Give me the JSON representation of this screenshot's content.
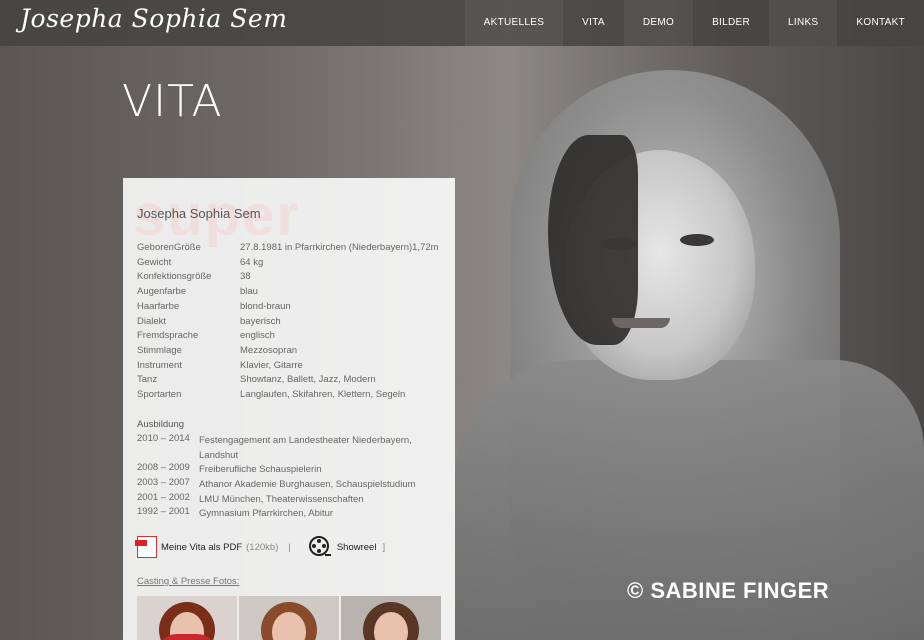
{
  "header": {
    "logo": "Josepha Sophia Sem",
    "nav": [
      "AKTUELLES",
      "VITA",
      "DEMO",
      "BILDER",
      "LINKS",
      "KONTAKT"
    ]
  },
  "page": {
    "title": "VITA",
    "copyright": "© SABINE FINGER"
  },
  "panel": {
    "bg_text": "super",
    "name": "Josepha Sophia Sem",
    "facts": [
      {
        "label": "GeborenGröße",
        "value": "27.8.1981 in Pfarrkirchen (Niederbayern)1,72m"
      },
      {
        "label": "Gewicht",
        "value": "64 kg"
      },
      {
        "label": "Konfektionsgröße",
        "value": "38"
      },
      {
        "label": "Augenfarbe",
        "value": "blau"
      },
      {
        "label": "Haarfarbe",
        "value": "blond-braun"
      },
      {
        "label": "Dialekt",
        "value": "bayerisch"
      },
      {
        "label": "Fremdsprache",
        "value": "englisch"
      },
      {
        "label": "Stimmlage",
        "value": "Mezzosopran"
      },
      {
        "label": "Instrument",
        "value": "Klavier, Gitarre"
      },
      {
        "label": "Tanz",
        "value": "Showtanz, Ballett, Jazz, Modern"
      },
      {
        "label": "Sportarten",
        "value": "Langlaufen, Skifahren, Klettern, Segeln"
      }
    ],
    "education_title": "Ausbildung",
    "education": [
      {
        "years": "2010 – 2014",
        "text": "Festengagement am Landestheater Niederbayern, Landshut"
      },
      {
        "years": "2008 – 2009",
        "text": "Freiberufliche Schauspielerin"
      },
      {
        "years": "2003 – 2007",
        "text": "Athanor Akademie Burghausen, Schauspielstudium"
      },
      {
        "years": "2001 – 2002",
        "text": "LMU München, Theaterwissenschaften"
      },
      {
        "years": "1992 – 2001",
        "text": "Gymnasium Pfarrkirchen, Abitur"
      }
    ],
    "pdf_label": "Meine Vita als PDF",
    "pdf_size": "(120kb)",
    "separator": "|",
    "showreel_label": "Showreel",
    "showreel_end": "]",
    "casting_label": "Casting & Presse Fotos:"
  },
  "colors": {
    "hair_thumb_1": "#7a2e18",
    "hair_thumb_2": "#8a4a2c",
    "hair_thumb_3": "#5a3626",
    "shirt_thumb_1": "#c8282c"
  }
}
